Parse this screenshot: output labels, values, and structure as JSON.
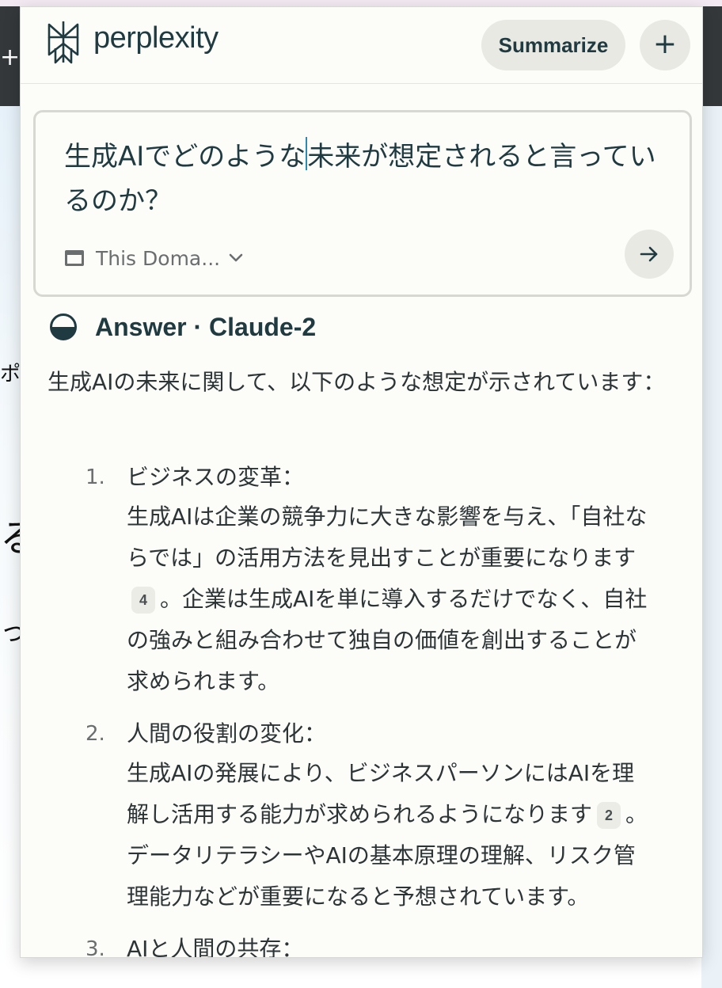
{
  "background": {
    "glyph_po": "ポ",
    "glyph_ru": "る",
    "glyph_tsu": "っ",
    "plus": "+"
  },
  "header": {
    "brand": "perplexity",
    "summarize_label": "Summarize",
    "new_label": "+"
  },
  "query": {
    "text_before_caret": "生成AIでどのような",
    "text_after_caret": "未来が想定されると言っているのか？",
    "focus_label": "This Doma...",
    "accent_color": "#2b8ab3"
  },
  "answer": {
    "title": "Answer · Claude-2",
    "intro": "生成AIの未来に関して、以下のような想定が示されています：",
    "items": [
      {
        "num": "1.",
        "title": "ビジネスの変革：",
        "body_a": "生成AIは企業の競争力に大きな影響を与え、「自社ならでは」の活用方法を見出すことが重要になります",
        "cite": "4",
        "body_b": "。企業は生成AIを単に導入するだけでなく、自社の強みと組み合わせて独自の価値を創出することが求められます。"
      },
      {
        "num": "2.",
        "title": "人間の役割の変化：",
        "body_a": "生成AIの発展により、ビジネスパーソンにはAIを理解し活用する能力が求められるようになります",
        "cite": "2",
        "body_b": "。データリテラシーやAIの基本原理の理解、リスク管理能力などが重要になると予想されています。"
      },
      {
        "num": "3.",
        "title": "AIと人間の共存："
      }
    ]
  }
}
